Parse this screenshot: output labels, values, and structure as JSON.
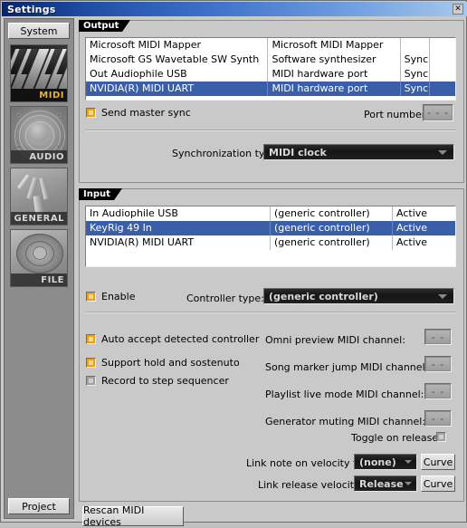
{
  "window": {
    "title": "Settings",
    "close_label": "✕"
  },
  "sidebar": {
    "system_button": "System",
    "project_button": "Project",
    "tiles": [
      {
        "label": "MIDI",
        "icon": "piano-keyboard-icon",
        "selected": true
      },
      {
        "label": "AUDIO",
        "icon": "speaker-icon",
        "selected": false
      },
      {
        "label": "GENERAL",
        "icon": "tuning-fork-icon",
        "selected": false
      },
      {
        "label": "FILE",
        "icon": "vinyl-disc-icon",
        "selected": false
      }
    ]
  },
  "output": {
    "group_label": "Output",
    "rows": [
      {
        "device": "Microsoft MIDI Mapper",
        "type": "Microsoft MIDI Mapper",
        "sync": "",
        "extra": "",
        "selected": false
      },
      {
        "device": "Microsoft GS Wavetable SW Synth",
        "type": "Software synthesizer",
        "sync": "Sync",
        "extra": "",
        "selected": false
      },
      {
        "device": "Out Audiophile USB",
        "type": "MIDI hardware port",
        "sync": "Sync",
        "extra": "",
        "selected": false
      },
      {
        "device": "NVIDIA(R) MIDI UART",
        "type": "MIDI hardware port",
        "sync": "Sync",
        "extra": "",
        "selected": true
      }
    ],
    "send_master_sync": {
      "label": "Send master sync",
      "checked": true
    },
    "port_number": {
      "label": "Port number:",
      "value": "- - -"
    },
    "sync_type": {
      "label": "Synchronization type:",
      "value": "MIDI clock"
    }
  },
  "input": {
    "group_label": "Input",
    "rows": [
      {
        "device": "In Audiophile USB",
        "type": "(generic controller)",
        "state": "Active",
        "selected": false
      },
      {
        "device": "KeyRig 49 In",
        "type": "(generic controller)",
        "state": "Active",
        "selected": true
      },
      {
        "device": "NVIDIA(R) MIDI UART",
        "type": "(generic controller)",
        "state": "Active",
        "selected": false
      }
    ],
    "enable": {
      "label": "Enable",
      "checked": true
    },
    "controller_type": {
      "label": "Controller type:",
      "value": "(generic controller)"
    },
    "checkboxes": [
      {
        "label": "Auto accept detected controller",
        "checked": true
      },
      {
        "label": "Support hold and sostenuto",
        "checked": true
      },
      {
        "label": "Record to step sequencer",
        "checked": false
      }
    ],
    "channels": [
      {
        "label": "Omni preview MIDI channel:",
        "value": "- -"
      },
      {
        "label": "Song marker jump MIDI channel:",
        "value": "- -"
      },
      {
        "label": "Playlist live mode MIDI channel:",
        "value": "- -"
      },
      {
        "label": "Generator muting MIDI channel:",
        "value": "- -"
      }
    ],
    "toggle_on_release": {
      "label": "Toggle on release",
      "checked": false
    },
    "link_note_on_velocity": {
      "label": "Link note on velocity to:",
      "value": "(none)",
      "button": "Curve"
    },
    "link_release_velocity": {
      "label": "Link release velocity to:",
      "value": "Release",
      "button": "Curve"
    }
  },
  "footer": {
    "rescan_button": "Rescan MIDI devices"
  }
}
